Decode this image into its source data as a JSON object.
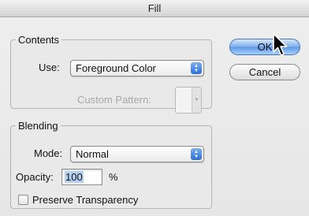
{
  "window": {
    "title": "Fill"
  },
  "contents": {
    "legend": "Contents",
    "use_label": "Use:",
    "use_value": "Foreground Color",
    "custom_pattern_label": "Custom Pattern:"
  },
  "blending": {
    "legend": "Blending",
    "mode_label": "Mode:",
    "mode_value": "Normal",
    "opacity_label": "Opacity:",
    "opacity_value": "100",
    "opacity_unit": "%",
    "preserve_label": "Preserve Transparency",
    "preserve_checked": false
  },
  "buttons": {
    "ok": "OK",
    "cancel": "Cancel"
  },
  "colors": {
    "accent": "#5d98e8"
  }
}
